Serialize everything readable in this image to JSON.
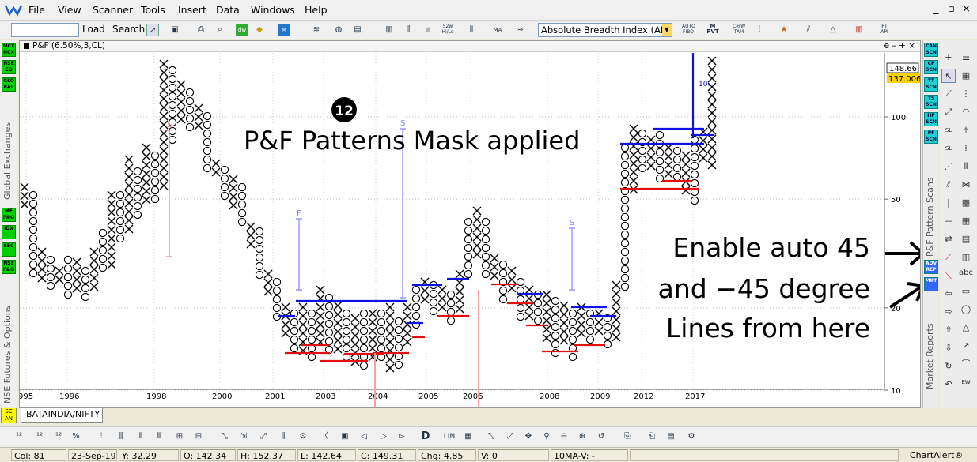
{
  "menubar": {
    "items": [
      "File",
      "View",
      "Scanner",
      "Tools",
      "Insert",
      "Data",
      "Windows",
      "Help"
    ]
  },
  "toolbar": {
    "symbol_input": "",
    "load_label": "Load",
    "search_label": "Search",
    "indicator_select": "Absolute Breadth Index (ABI",
    "icon_labels": [
      "52w Hi/Lo",
      "MA",
      "AUTO FIBO",
      "M PVT",
      "C@W TAM",
      "RT API"
    ]
  },
  "left_rail": {
    "badges": [
      "MCX NCX",
      "NSE CD",
      "GLO BAL",
      "MF F&O",
      "IDX",
      "SEC",
      "NSE F&O"
    ],
    "vertical_labels": [
      "Global Exchanges",
      "NSE Futures & Options"
    ]
  },
  "chart": {
    "title": "P&F (6.50%,3,CL)",
    "frame_controls": "e – + ×",
    "annotation_number": "12",
    "mask_text": "P&F Patterns Mask applied",
    "callout_lines": [
      "Enable auto 45",
      "and −45 degree",
      "Lines from here"
    ],
    "price_labels": [
      "148.66",
      "137.006"
    ],
    "pattern_markers": [
      "S",
      "F",
      "S",
      "S",
      "101"
    ]
  },
  "chart_data": {
    "type": "table",
    "y_axis_scale": "log",
    "y_ticks": [
      100,
      50,
      20,
      10
    ],
    "x_ticks": [
      "995",
      "1996",
      "1998",
      "2000",
      "2001",
      "2003",
      "2004",
      "2005",
      "2006",
      "2008",
      "2009",
      "2012",
      "2017"
    ],
    "last_prices": [
      148.66,
      137.006
    ]
  },
  "right_scan": {
    "badges": [
      "CAN SCN",
      "CP SCN",
      "TT SCN",
      "TS SCN",
      "HP SCN",
      "PF SCN",
      "ADV REP",
      "MKT"
    ],
    "vertical_labels": [
      "P&F Pattern Scans",
      "Market Reports"
    ]
  },
  "tabs": {
    "active": "BATAINDIA/NIFTY"
  },
  "bottom_toolbar": {
    "labels": [
      "LIN"
    ]
  },
  "statusbar": {
    "col": "Col: 81",
    "date": "23-Sep-19",
    "y": "Y: 32.29",
    "open": "O: 142.34",
    "high": "H: 152.37",
    "low": "L: 142.64",
    "close": "C: 149.31",
    "chg": "Chg: 4.85",
    "volume": "V: 0",
    "ma": "10MA-V: -",
    "brand": "ChartAlert®"
  },
  "colors": {
    "pf_x": "#000000",
    "pf_o": "#000000",
    "resistance": "#1010e0",
    "support": "#e01010",
    "target_up": "#8080ff",
    "target_down": "#ff8080",
    "price_label_bg1": "#ffffff",
    "price_label_bg2": "#ffd200"
  }
}
